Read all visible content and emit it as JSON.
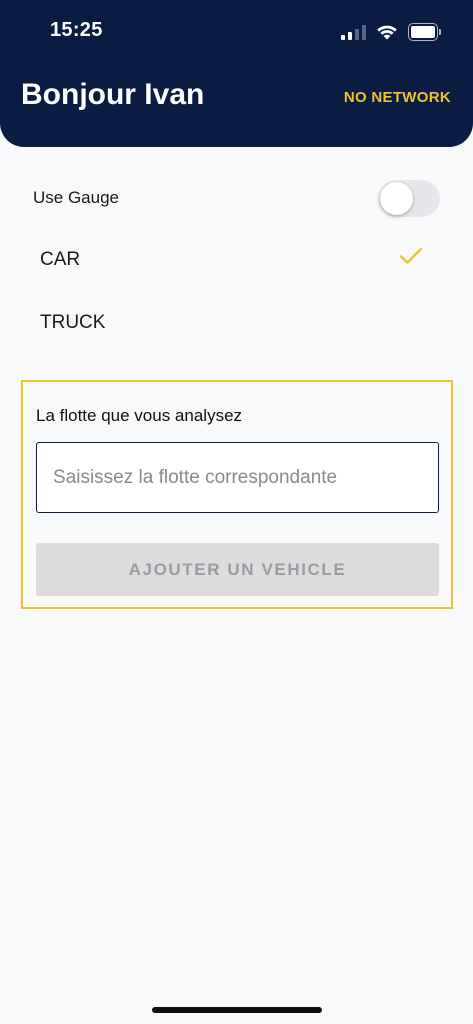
{
  "status_bar": {
    "time": "15:25",
    "signal_icon": "cellular-signal-icon",
    "wifi_icon": "wifi-icon",
    "battery_icon": "battery-icon"
  },
  "header": {
    "greeting": "Bonjour Ivan",
    "network_status": "NO NETWORK",
    "background_color": "#0A1C42",
    "accent_color": "#F2C12E"
  },
  "settings": {
    "use_gauge_label": "Use Gauge",
    "use_gauge_enabled": false
  },
  "vehicle_types": [
    {
      "label": "CAR",
      "selected": true
    },
    {
      "label": "TRUCK",
      "selected": false
    }
  ],
  "fleet_panel": {
    "label": "La flotte que vous analysez",
    "input_value": "",
    "input_placeholder": "Saisissez la flotte correspondante",
    "add_button_label": "AJOUTER UN VEHICLE",
    "add_button_enabled": false
  }
}
